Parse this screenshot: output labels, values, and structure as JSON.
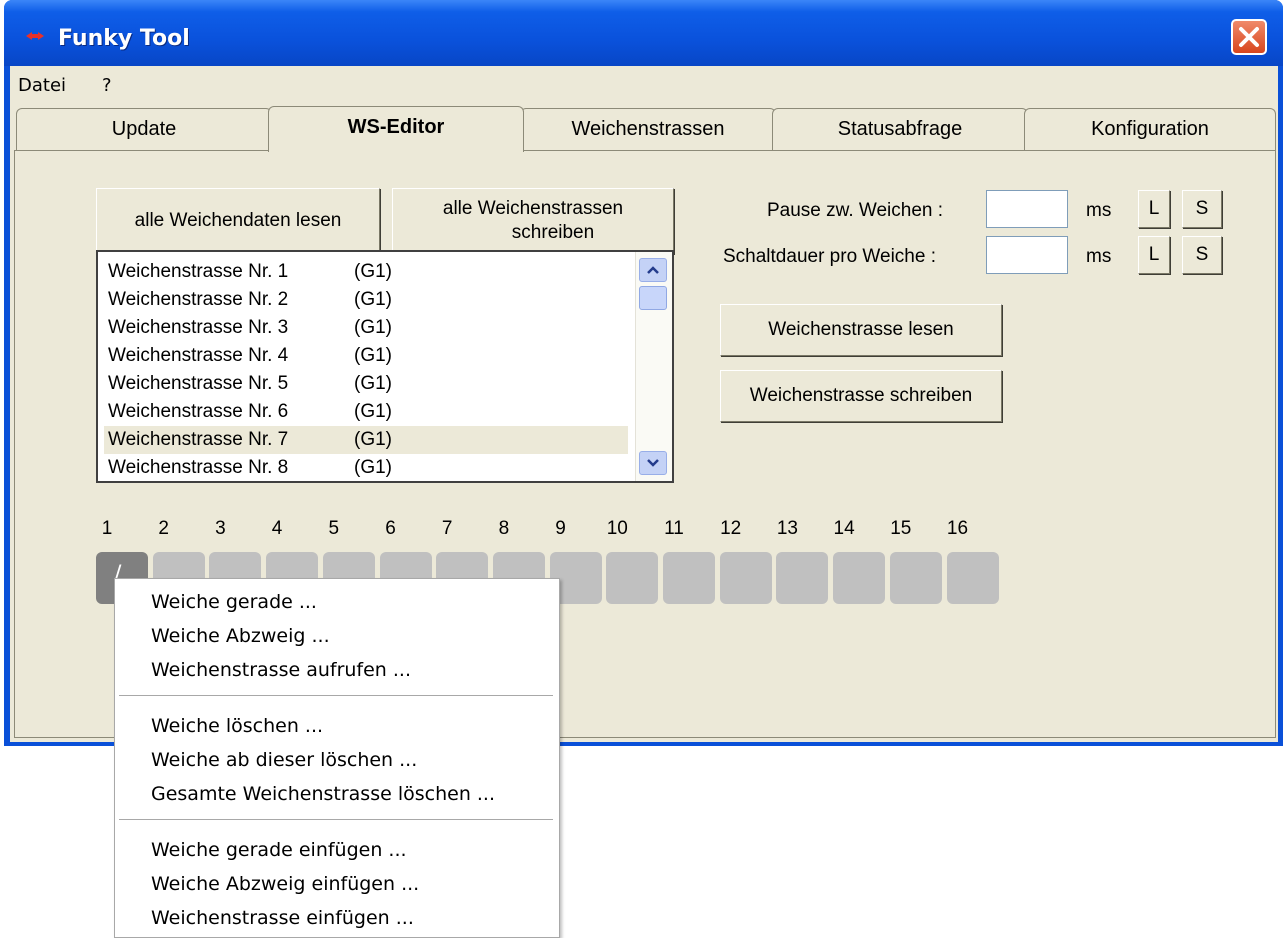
{
  "window": {
    "title": "Funky Tool",
    "close": "✕"
  },
  "menubar": [
    "Datei",
    "?"
  ],
  "tabs": [
    "Update",
    "WS-Editor",
    "Weichenstrassen",
    "Statusabfrage",
    "Konfiguration"
  ],
  "active_tab": "WS-Editor",
  "buttons": {
    "read_all": "alle Weichendaten lesen",
    "write_all_line1": "alle Weichenstrassen",
    "write_all_line2": "schreiben",
    "read_one": "Weichenstrasse lesen",
    "write_one": "Weichenstrasse schreiben"
  },
  "settings": {
    "pause_label": "Pause zw. Weichen :",
    "pause_value": "",
    "pause_unit": "ms",
    "duration_label": "Schaltdauer pro Weiche :",
    "duration_value": "",
    "duration_unit": "ms",
    "load_button": "L",
    "save_button": "S"
  },
  "list": {
    "selected_index": 6,
    "rows": [
      {
        "name": "Weichenstrasse Nr. 1",
        "group": "(G1)"
      },
      {
        "name": "Weichenstrasse Nr. 2",
        "group": "(G1)"
      },
      {
        "name": "Weichenstrasse Nr. 3",
        "group": "(G1)"
      },
      {
        "name": "Weichenstrasse Nr. 4",
        "group": "(G1)"
      },
      {
        "name": "Weichenstrasse Nr. 5",
        "group": "(G1)"
      },
      {
        "name": "Weichenstrasse Nr. 6",
        "group": "(G1)"
      },
      {
        "name": "Weichenstrasse Nr. 7",
        "group": "(G1)"
      },
      {
        "name": "Weichenstrasse Nr. 8",
        "group": "(G1)"
      }
    ]
  },
  "slots": {
    "numbers": [
      "1",
      "2",
      "3",
      "4",
      "5",
      "6",
      "7",
      "8",
      "9",
      "10",
      "11",
      "12",
      "13",
      "14",
      "15",
      "16"
    ],
    "active_index": 0,
    "active_symbol": "/"
  },
  "context_menu": {
    "group1": [
      "Weiche gerade ...",
      "Weiche Abzweig ...",
      "Weichenstrasse aufrufen ..."
    ],
    "group2": [
      "Weiche löschen ...",
      "Weiche ab dieser löschen ...",
      "Gesamte Weichenstrasse löschen ..."
    ],
    "group3": [
      "Weiche gerade einfügen ...",
      "Weiche Abzweig einfügen ...",
      "Weichenstrasse einfügen ..."
    ]
  },
  "colors": {
    "titlebar": "#0a52dc",
    "client": "#ece9d8",
    "close": "#d8461e",
    "cell": "#c0c0c0",
    "cell_active": "#808080"
  }
}
